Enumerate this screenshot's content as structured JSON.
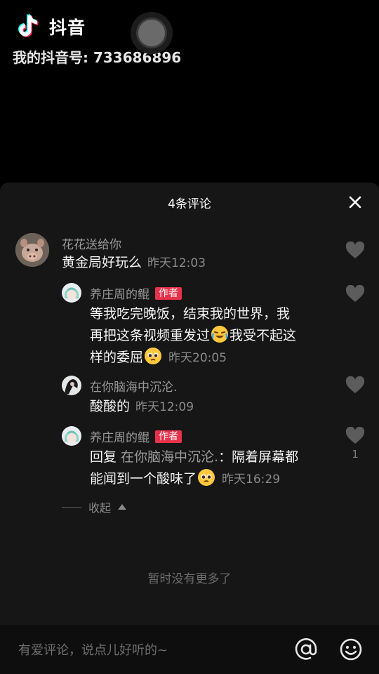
{
  "header": {
    "app_name": "抖音",
    "douyin_id": "我的抖音号: 733686896"
  },
  "sheet": {
    "title": "4条评论",
    "close_icon": "close-icon",
    "collapse_label": "收起",
    "no_more": "暂时没有更多了"
  },
  "comments": [
    {
      "user": "花花送给你",
      "text": "黄金局好玩么",
      "time": "昨天12:03"
    },
    {
      "user": "养庄周的鲲",
      "badge": "作者",
      "text_line1": "等我吃完晚饭，结束我的世界，我",
      "text_line2a": "再把这条视频重发过",
      "text_line2b": "我受不起这",
      "text_line3": "样的委屈",
      "time": "昨天20:05"
    },
    {
      "user": "在你脑海中沉沦.",
      "text": "酸酸的",
      "time": "昨天12:09"
    },
    {
      "user": "养庄周的鲲",
      "badge": "作者",
      "reply_prefix": "回复 ",
      "reply_to": "在你脑海中沉沦.",
      "text_line1": "：隔着屏幕都",
      "text_line2": "能闻到一个酸味了",
      "time": "昨天16:29",
      "likes": "1"
    }
  ],
  "input": {
    "placeholder": "有爱评论，说点儿好听的~",
    "at_label": "@"
  },
  "colors": {
    "author_badge": "#e8324b",
    "sheet_bg": "#161616",
    "input_bg": "#0e0e0e"
  }
}
